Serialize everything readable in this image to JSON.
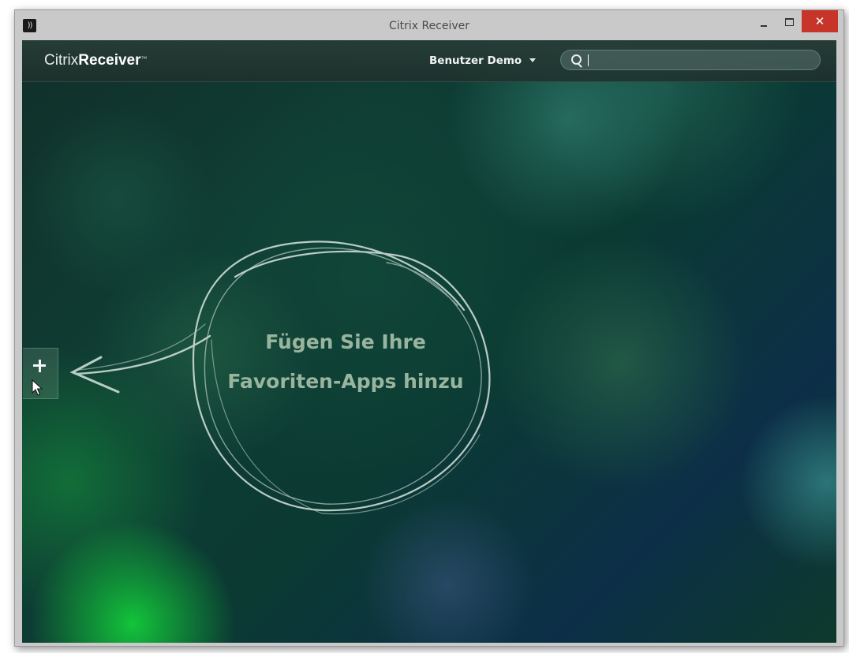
{
  "window": {
    "title": "Citrix Receiver",
    "minimize_label": "–",
    "maximize_label": "□",
    "close_label": "✕"
  },
  "header": {
    "brand_light": "Citrix",
    "brand_bold": "Receiver",
    "brand_tm": "™",
    "user_menu_label": "Benutzer Demo",
    "search_value": "",
    "search_placeholder": ""
  },
  "main": {
    "add_button_label": "+",
    "callout_line1": "Fügen Sie Ihre",
    "callout_line2": "Favoriten-Apps hinzu"
  },
  "colors": {
    "close_button": "#c7352a",
    "callout_text": "#9ab59f",
    "chalk": "#d9e6df"
  },
  "icons": {
    "app_icon": "citrix-receiver-logo-icon",
    "search": "search-icon",
    "dropdown": "chevron-down-icon",
    "add": "plus-icon",
    "pointer": "mouse-pointer-icon",
    "arrow": "chalk-arrow-icon"
  }
}
